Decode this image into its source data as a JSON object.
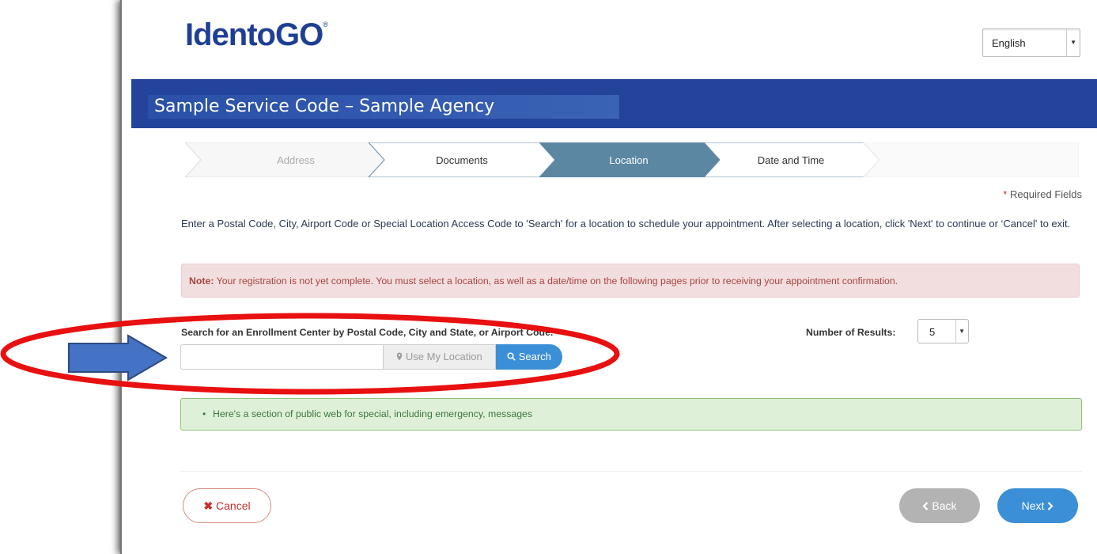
{
  "brand": {
    "logo_text": "IdentoGO",
    "registered_mark": "®"
  },
  "language": {
    "selected": "English"
  },
  "banner": {
    "title": "Sample Service Code – Sample Agency"
  },
  "steps": [
    {
      "label": "Address",
      "state": "completed"
    },
    {
      "label": "Documents",
      "state": "completed"
    },
    {
      "label": "Location",
      "state": "active"
    },
    {
      "label": "Date and Time",
      "state": "upcoming"
    }
  ],
  "required_fields": {
    "star": "*",
    "label": "Required Fields"
  },
  "intro_text": "Enter a Postal Code, City, Airport Code or Special Location Access Code to 'Search' for a location to schedule your appointment. After selecting a location, click 'Next' to continue or ‘Cancel' to exit.",
  "note": {
    "prefix": "Note:",
    "text": " Your registration is not yet complete. You must select a location, as well as a date/time on the following pages prior to receiving your appointment confirmation."
  },
  "search": {
    "label": "Search for an Enrollment Center by Postal Code, City and State, or Airport Code.",
    "input_value": "",
    "use_location_label": "Use My Location",
    "search_button_label": "Search"
  },
  "results": {
    "label": "Number of Results:",
    "selected": "5"
  },
  "message": {
    "bullet": "•",
    "text": "Here's a section of public web for special, including emergency, messages"
  },
  "buttons": {
    "cancel": "Cancel",
    "back": "Back",
    "next": "Next"
  },
  "colors": {
    "brand_blue": "#1f3f93",
    "banner_blue": "#23449a",
    "step_active": "#5b87a3",
    "primary_button": "#3b8fd6",
    "annotation_red": "#e81010",
    "annotation_arrow": "#4472c4"
  },
  "icons": {
    "location": "map-marker-icon",
    "search": "magnifier-icon",
    "cancel": "x-icon",
    "back": "chevron-left-icon",
    "next": "chevron-right-icon"
  }
}
